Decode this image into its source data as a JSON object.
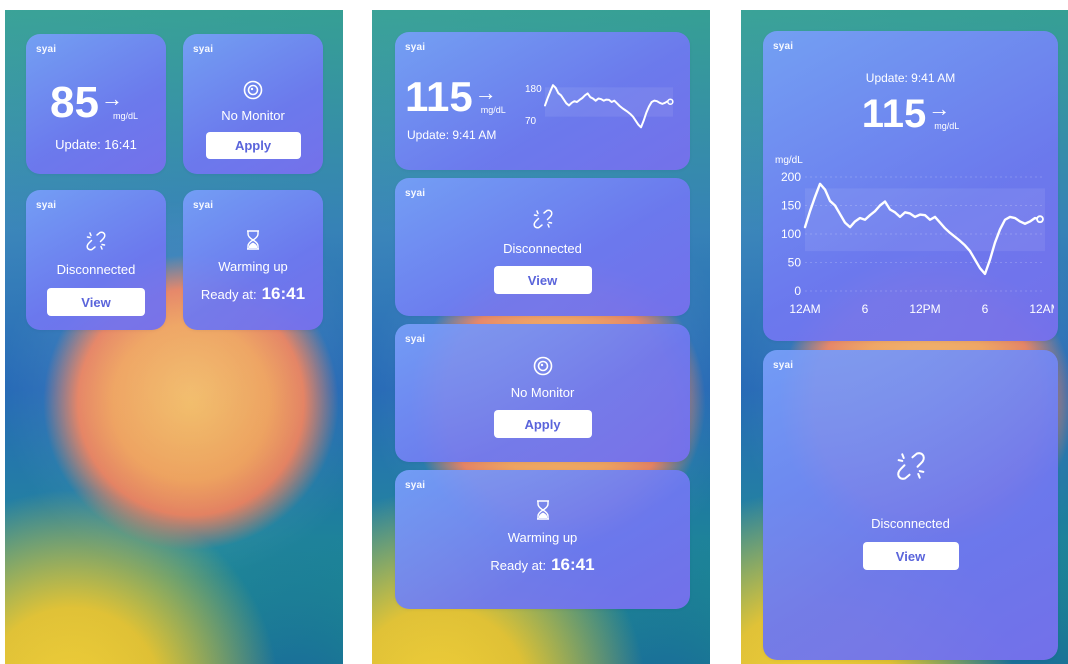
{
  "brand": "syai",
  "glucose_small": {
    "value": "85",
    "arrow": "→",
    "unit": "mg/dL",
    "update": "Update: 16:41"
  },
  "no_monitor": {
    "title": "No Monitor",
    "button": "Apply"
  },
  "disconnected": {
    "title": "Disconnected",
    "button": "View"
  },
  "warming": {
    "title": "Warming up",
    "ready_label": "Ready at:",
    "ready_time": "16:41"
  },
  "glucose_medium": {
    "value": "115",
    "arrow": "→",
    "unit": "mg/dL",
    "update": "Update: 9:41 AM",
    "range_high": "180",
    "range_low": "70"
  },
  "glucose_large": {
    "update": "Update: 9:41 AM",
    "value": "115",
    "arrow": "→",
    "unit": "mg/dL"
  },
  "chart_data": {
    "type": "line",
    "ylabel": "mg/dL",
    "ylim": [
      0,
      200
    ],
    "y_ticks": [
      "200",
      "150",
      "100",
      "50",
      "0"
    ],
    "x_ticks": [
      "12AM",
      "6",
      "12PM",
      "6",
      "12AM"
    ],
    "x_hours": [
      0,
      0.5,
      1,
      1.5,
      2,
      2.5,
      3,
      3.5,
      4,
      4.5,
      5,
      5.5,
      6,
      6.5,
      7,
      7.5,
      8,
      8.5,
      9,
      9.5,
      10,
      10.5,
      11,
      11.5,
      12,
      12.5,
      13,
      13.5,
      14,
      14.5,
      15,
      15.5,
      16,
      16.5,
      17,
      17.5,
      18,
      18.5,
      19,
      19.5,
      20,
      20.5,
      21,
      21.5,
      22,
      22.5,
      23,
      23.5
    ],
    "values": [
      112,
      140,
      165,
      188,
      178,
      158,
      150,
      135,
      120,
      112,
      122,
      128,
      125,
      133,
      140,
      150,
      157,
      143,
      138,
      130,
      138,
      136,
      130,
      134,
      133,
      125,
      130,
      120,
      110,
      102,
      95,
      88,
      80,
      70,
      55,
      40,
      30,
      55,
      85,
      108,
      125,
      130,
      128,
      122,
      118,
      122,
      128,
      126
    ],
    "range_low": 70,
    "range_high": 180,
    "grid": true
  },
  "colors": {
    "button_text": "#5a64db",
    "widget_start": "#78a0fa",
    "widget_end": "#7670ec"
  }
}
